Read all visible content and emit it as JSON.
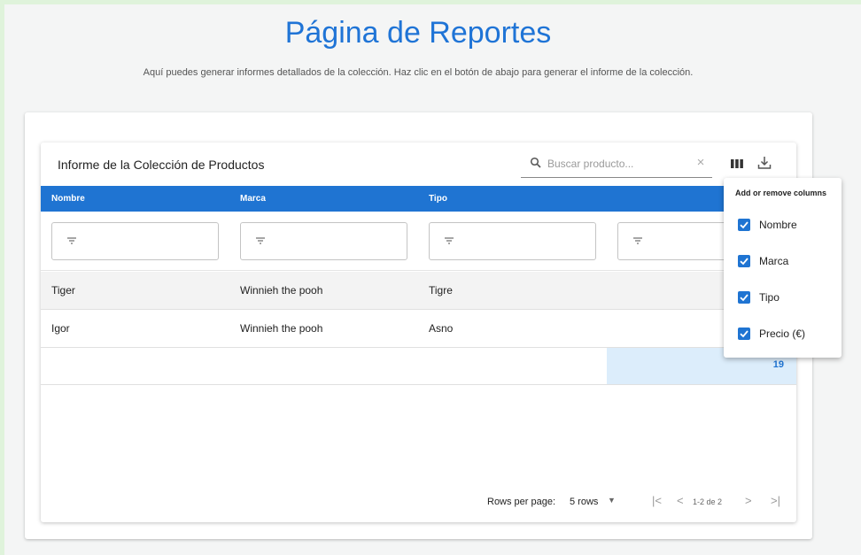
{
  "page": {
    "title": "Página de Reportes",
    "description": "Aquí puedes generar informes detallados de la colección. Haz clic en el botón de abajo para generar el informe de la colección."
  },
  "report": {
    "title": "Informe de la Colección de Productos",
    "search": {
      "placeholder": "Buscar producto...",
      "value": ""
    },
    "columns": [
      "Nombre",
      "Marca",
      "Tipo"
    ],
    "rows": [
      {
        "nombre": "Tiger",
        "marca": "Winnieh the pooh",
        "tipo": "Tigre"
      },
      {
        "nombre": "Igor",
        "marca": "Winnieh the pooh",
        "tipo": "Asno"
      }
    ],
    "total": "19"
  },
  "pagination": {
    "rows_per_page_label": "Rows per page:",
    "rows_per_page_value": "5 rows",
    "range": "1-2 de 2"
  },
  "column_menu": {
    "title": "Add or remove columns",
    "items": [
      {
        "label": "Nombre",
        "checked": true
      },
      {
        "label": "Marca",
        "checked": true
      },
      {
        "label": "Tipo",
        "checked": true
      },
      {
        "label": "Precio (€)",
        "checked": true
      }
    ]
  },
  "colors": {
    "accent": "#1f74d2",
    "title": "#1f74d6",
    "total_highlight": "#dcedfb",
    "frame": "#dff3db"
  },
  "icons": [
    "search-icon",
    "clear-icon",
    "view-columns-icon",
    "download-icon",
    "filter-icon",
    "first-page-icon",
    "previous-page-icon",
    "next-page-icon",
    "last-page-icon",
    "dropdown-arrow-icon",
    "checkmark-icon"
  ]
}
